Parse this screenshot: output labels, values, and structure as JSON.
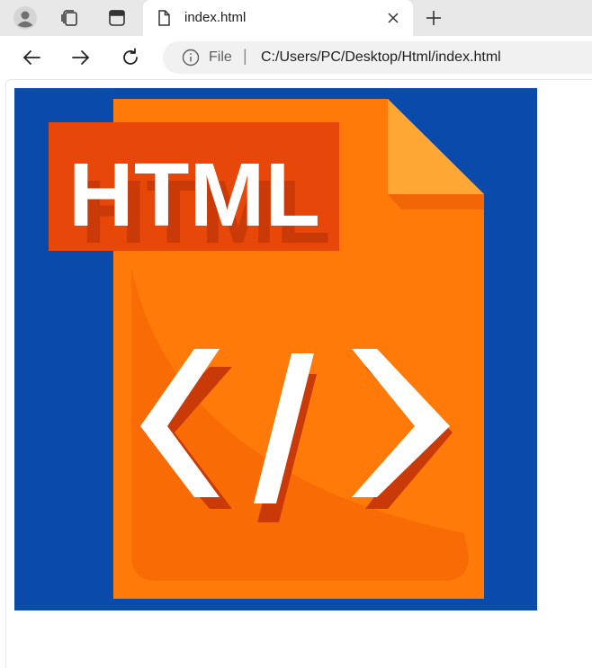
{
  "tabs": [
    {
      "title": "index.html",
      "active": true
    }
  ],
  "addressbar": {
    "scheme_label": "File",
    "separator": "|",
    "url": "C:/Users/PC/Desktop/Html/index.html"
  },
  "page": {
    "image": {
      "logo_text": "HTML",
      "code_glyph": "</>",
      "colors": {
        "background": "#0a4aab",
        "document": "#ff7a08",
        "fold": "#ffa735",
        "label": "#e8470a",
        "text": "#ffffff"
      }
    }
  },
  "icons": {
    "profile": "profile-icon",
    "collections": "collections-icon",
    "tab_actions": "tab-actions-icon",
    "file": "file-icon",
    "close": "close-icon",
    "new_tab": "plus-icon",
    "back": "back-arrow-icon",
    "forward": "forward-arrow-icon",
    "reload": "reload-icon",
    "info": "info-icon"
  }
}
